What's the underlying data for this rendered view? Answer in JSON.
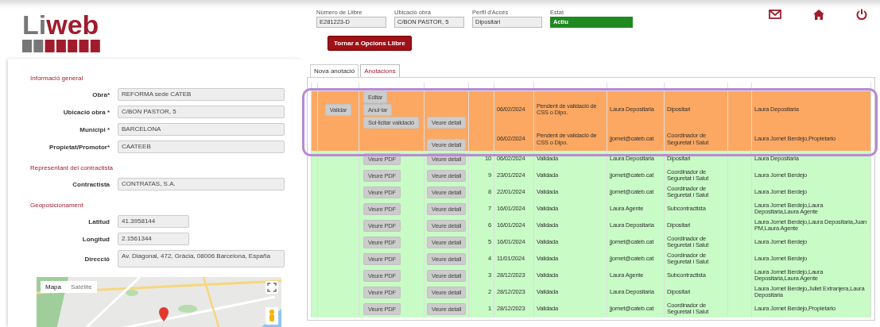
{
  "logo": {
    "lead": "Li",
    "rest": "web"
  },
  "header": {
    "fields": [
      {
        "label": "Número de Llibre",
        "value": "E281223-D",
        "kind": "text"
      },
      {
        "label": "Ubicació obra",
        "value": "C/BON PASTOR, 5",
        "kind": "text"
      },
      {
        "label": "Perfil d'Accés",
        "value": "Dipositari",
        "kind": "text"
      },
      {
        "label": "Estat",
        "value": "Actiu",
        "kind": "status"
      }
    ],
    "return_button": "Tornar a Opcions Llibre"
  },
  "form": {
    "sections": [
      {
        "title": "Informació general",
        "fields": [
          {
            "label": "Obra*",
            "value": "REFORMA sede CATEB",
            "kind": "wide"
          },
          {
            "label": "Ubicació obra *",
            "value": "C/BON PASTOR, 5",
            "kind": "wide"
          },
          {
            "label": "Municipi *",
            "value": "BARCELONA",
            "kind": "wide"
          },
          {
            "label": "Propietat/Promotor*",
            "value": "CAATEEB",
            "kind": "wide"
          }
        ]
      },
      {
        "title": "Representant del contractista",
        "fields": [
          {
            "label": "Contractista",
            "value": "CONTRATAS, S.A.",
            "kind": "wide"
          }
        ]
      },
      {
        "title": "Geoposicionament",
        "fields": [
          {
            "label": "Latitud",
            "value": "41.3958144",
            "kind": "short"
          },
          {
            "label": "Longitud",
            "value": "2.1561344",
            "kind": "short"
          },
          {
            "label": "Direcció",
            "value": "Av. Diagonal, 472, Gràcia, 08006 Barcelona, España",
            "kind": "area"
          }
        ]
      }
    ]
  },
  "map": {
    "view_options": [
      {
        "label": "Mapa",
        "selected": true
      },
      {
        "label": "Satélite",
        "selected": false
      }
    ]
  },
  "tabs": [
    {
      "label": "Nova anotació",
      "selected": false
    },
    {
      "label": "Anotacions",
      "selected": true
    }
  ],
  "table": {
    "rows": [
      {
        "kind": "pending",
        "validate": "Validar",
        "actions": [
          "Editar",
          "Anul·lar",
          "Sol·licitar validació"
        ],
        "detail": "Veure detall",
        "number": "",
        "date": "06/02/2024",
        "status": "Pendent de validació de CSS o Dipo.",
        "user": "Laura Depositaria",
        "profile": "Dipositari",
        "recipients": "Laura Depositaria"
      },
      {
        "kind": "pending",
        "actions": [],
        "detail": "Veure detall",
        "number": "",
        "date": "06/02/2024",
        "status": "Pendent de validació de CSS o Dipo.",
        "user": "jjornet@cateb.cat",
        "profile": "Coordinador de Seguretat i Salut",
        "recipients": "Laura Jornet Berdejo,Propietario"
      },
      {
        "kind": "validated",
        "actions": [
          "Veure PDF"
        ],
        "detail": "Veure detall",
        "number": "10",
        "date": "06/02/2024",
        "status": "Validada",
        "user": "Laura Depositaria",
        "profile": "Dipositari",
        "recipients": "Laura Depositaria"
      },
      {
        "kind": "validated",
        "actions": [
          "Veure PDF"
        ],
        "detail": "Veure detall",
        "number": "9",
        "date": "23/01/2024",
        "status": "Validada",
        "user": "jjornet@cateb.cat",
        "profile": "Coordinador de Seguretat i Salut",
        "recipients": "Laura Jornet Berdejo"
      },
      {
        "kind": "validated",
        "actions": [
          "Veure PDF"
        ],
        "detail": "Veure detall",
        "number": "8",
        "date": "22/01/2024",
        "status": "Validada",
        "user": "jjornet@cateb.cat",
        "profile": "Coordinador de Seguretat i Salut",
        "recipients": "Laura Jornet Berdejo"
      },
      {
        "kind": "validated",
        "actions": [
          "Veure PDF"
        ],
        "detail": "Veure detall",
        "number": "7",
        "date": "16/01/2024",
        "status": "Validada",
        "user": "Laura Agente",
        "profile": "Subcontractista",
        "recipients": "Laura Jornet Berdejo,Laura Depositaria,Laura Agente"
      },
      {
        "kind": "validated",
        "actions": [
          "Veure PDF"
        ],
        "detail": "Veure detall",
        "number": "6",
        "date": "16/01/2024",
        "status": "Validada",
        "user": "Laura Depositaria",
        "profile": "Dipositari",
        "recipients": "Laura Jornet Berdejo,Laura Depositaria,Juan PM,Laura Agente"
      },
      {
        "kind": "validated",
        "actions": [
          "Veure PDF"
        ],
        "detail": "Veure detall",
        "number": "5",
        "date": "16/01/2024",
        "status": "Validada",
        "user": "jjornet@cateb.cat",
        "profile": "Coordinador de Seguretat i Salut",
        "recipients": "Laura Jornet Berdejo"
      },
      {
        "kind": "validated",
        "actions": [
          "Veure PDF"
        ],
        "detail": "Veure detall",
        "number": "4",
        "date": "11/01/2024",
        "status": "Validada",
        "user": "jjornet@cateb.cat",
        "profile": "Coordinador de Seguretat i Salut",
        "recipients": "Laura Jornet Berdejo"
      },
      {
        "kind": "validated",
        "actions": [
          "Veure PDF"
        ],
        "detail": "Veure detall",
        "number": "3",
        "date": "28/12/2023",
        "status": "Validada",
        "user": "Laura Agente",
        "profile": "Subcontractista",
        "recipients": "Laura Jornet Berdejo,Laura Depositaria,Laura Agente"
      },
      {
        "kind": "validated",
        "actions": [
          "Veure PDF"
        ],
        "detail": "Veure detall",
        "number": "2",
        "date": "28/12/2023",
        "status": "Validada",
        "user": "Laura Depositaria",
        "profile": "Dipositari",
        "recipients": "Laura Jornet Berdejo,Juliet Extranjera,Laura Depositaria"
      },
      {
        "kind": "validated",
        "actions": [
          "Veure PDF"
        ],
        "detail": "Veure detall",
        "number": "1",
        "date": "28/12/2023",
        "status": "Validada",
        "user": "jjornet@cateb.cat",
        "profile": "Coordinador de Seguretat i Salut",
        "recipients": "Laura Jornet Berdejo,Propietario"
      }
    ]
  }
}
